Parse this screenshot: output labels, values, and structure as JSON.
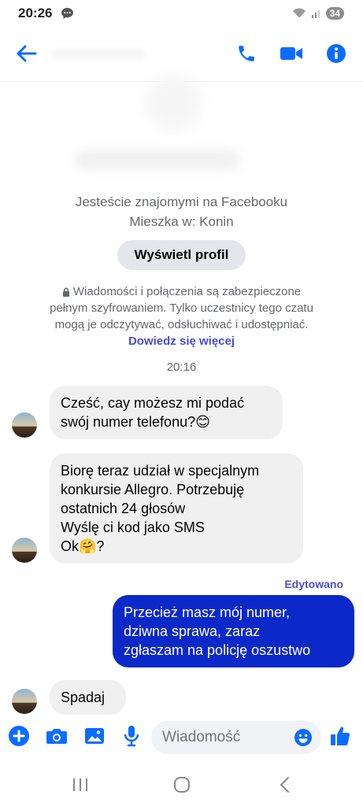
{
  "status_bar": {
    "time": "20:26",
    "battery": "34"
  },
  "header": {
    "back_label": "back",
    "call": "voice call",
    "video": "video call",
    "info": "info"
  },
  "profile": {
    "friends_text": "Jesteście znajomymi na Facebooku",
    "location_text": "Mieszka w: Konin",
    "view_profile_label": "Wyświetl profil"
  },
  "encryption": {
    "text": "Wiadomości i połączenia są zabezpieczone pełnym szyfrowaniem. Tylko uczestnicy tego czatu mogą je odczytywać, odsłuchiwać i udostępniać.",
    "learn_more": "Dowiedz się więcej"
  },
  "chat": {
    "timestamp": "20:16",
    "messages": [
      {
        "from": "them",
        "lines": [
          "Cześć, cay możesz mi podać",
          "swój numer telefonu?😊"
        ]
      },
      {
        "from": "them",
        "lines": [
          "Biorę teraz udział w specjalnym",
          "konkursie Allegro. Potrzebuję",
          "ostatnich 24 głosów",
          "Wyślę ci kod jako SMS",
          "Ok🤗?"
        ]
      },
      {
        "from": "me",
        "edited_label": "Edytowano",
        "lines": [
          "Przecież masz mój numer,",
          "dziwna sprawa, zaraz",
          "zgłaszam na policję oszustwo"
        ]
      },
      {
        "from": "them",
        "lines": [
          "Spadaj"
        ]
      }
    ]
  },
  "composer": {
    "placeholder": "Wiadomość"
  },
  "colors": {
    "accent": "#0a6cff",
    "outgoing_bubble": "#0a29c8",
    "incoming_bubble": "#f0f0f0",
    "link": "#4b4ccf"
  }
}
